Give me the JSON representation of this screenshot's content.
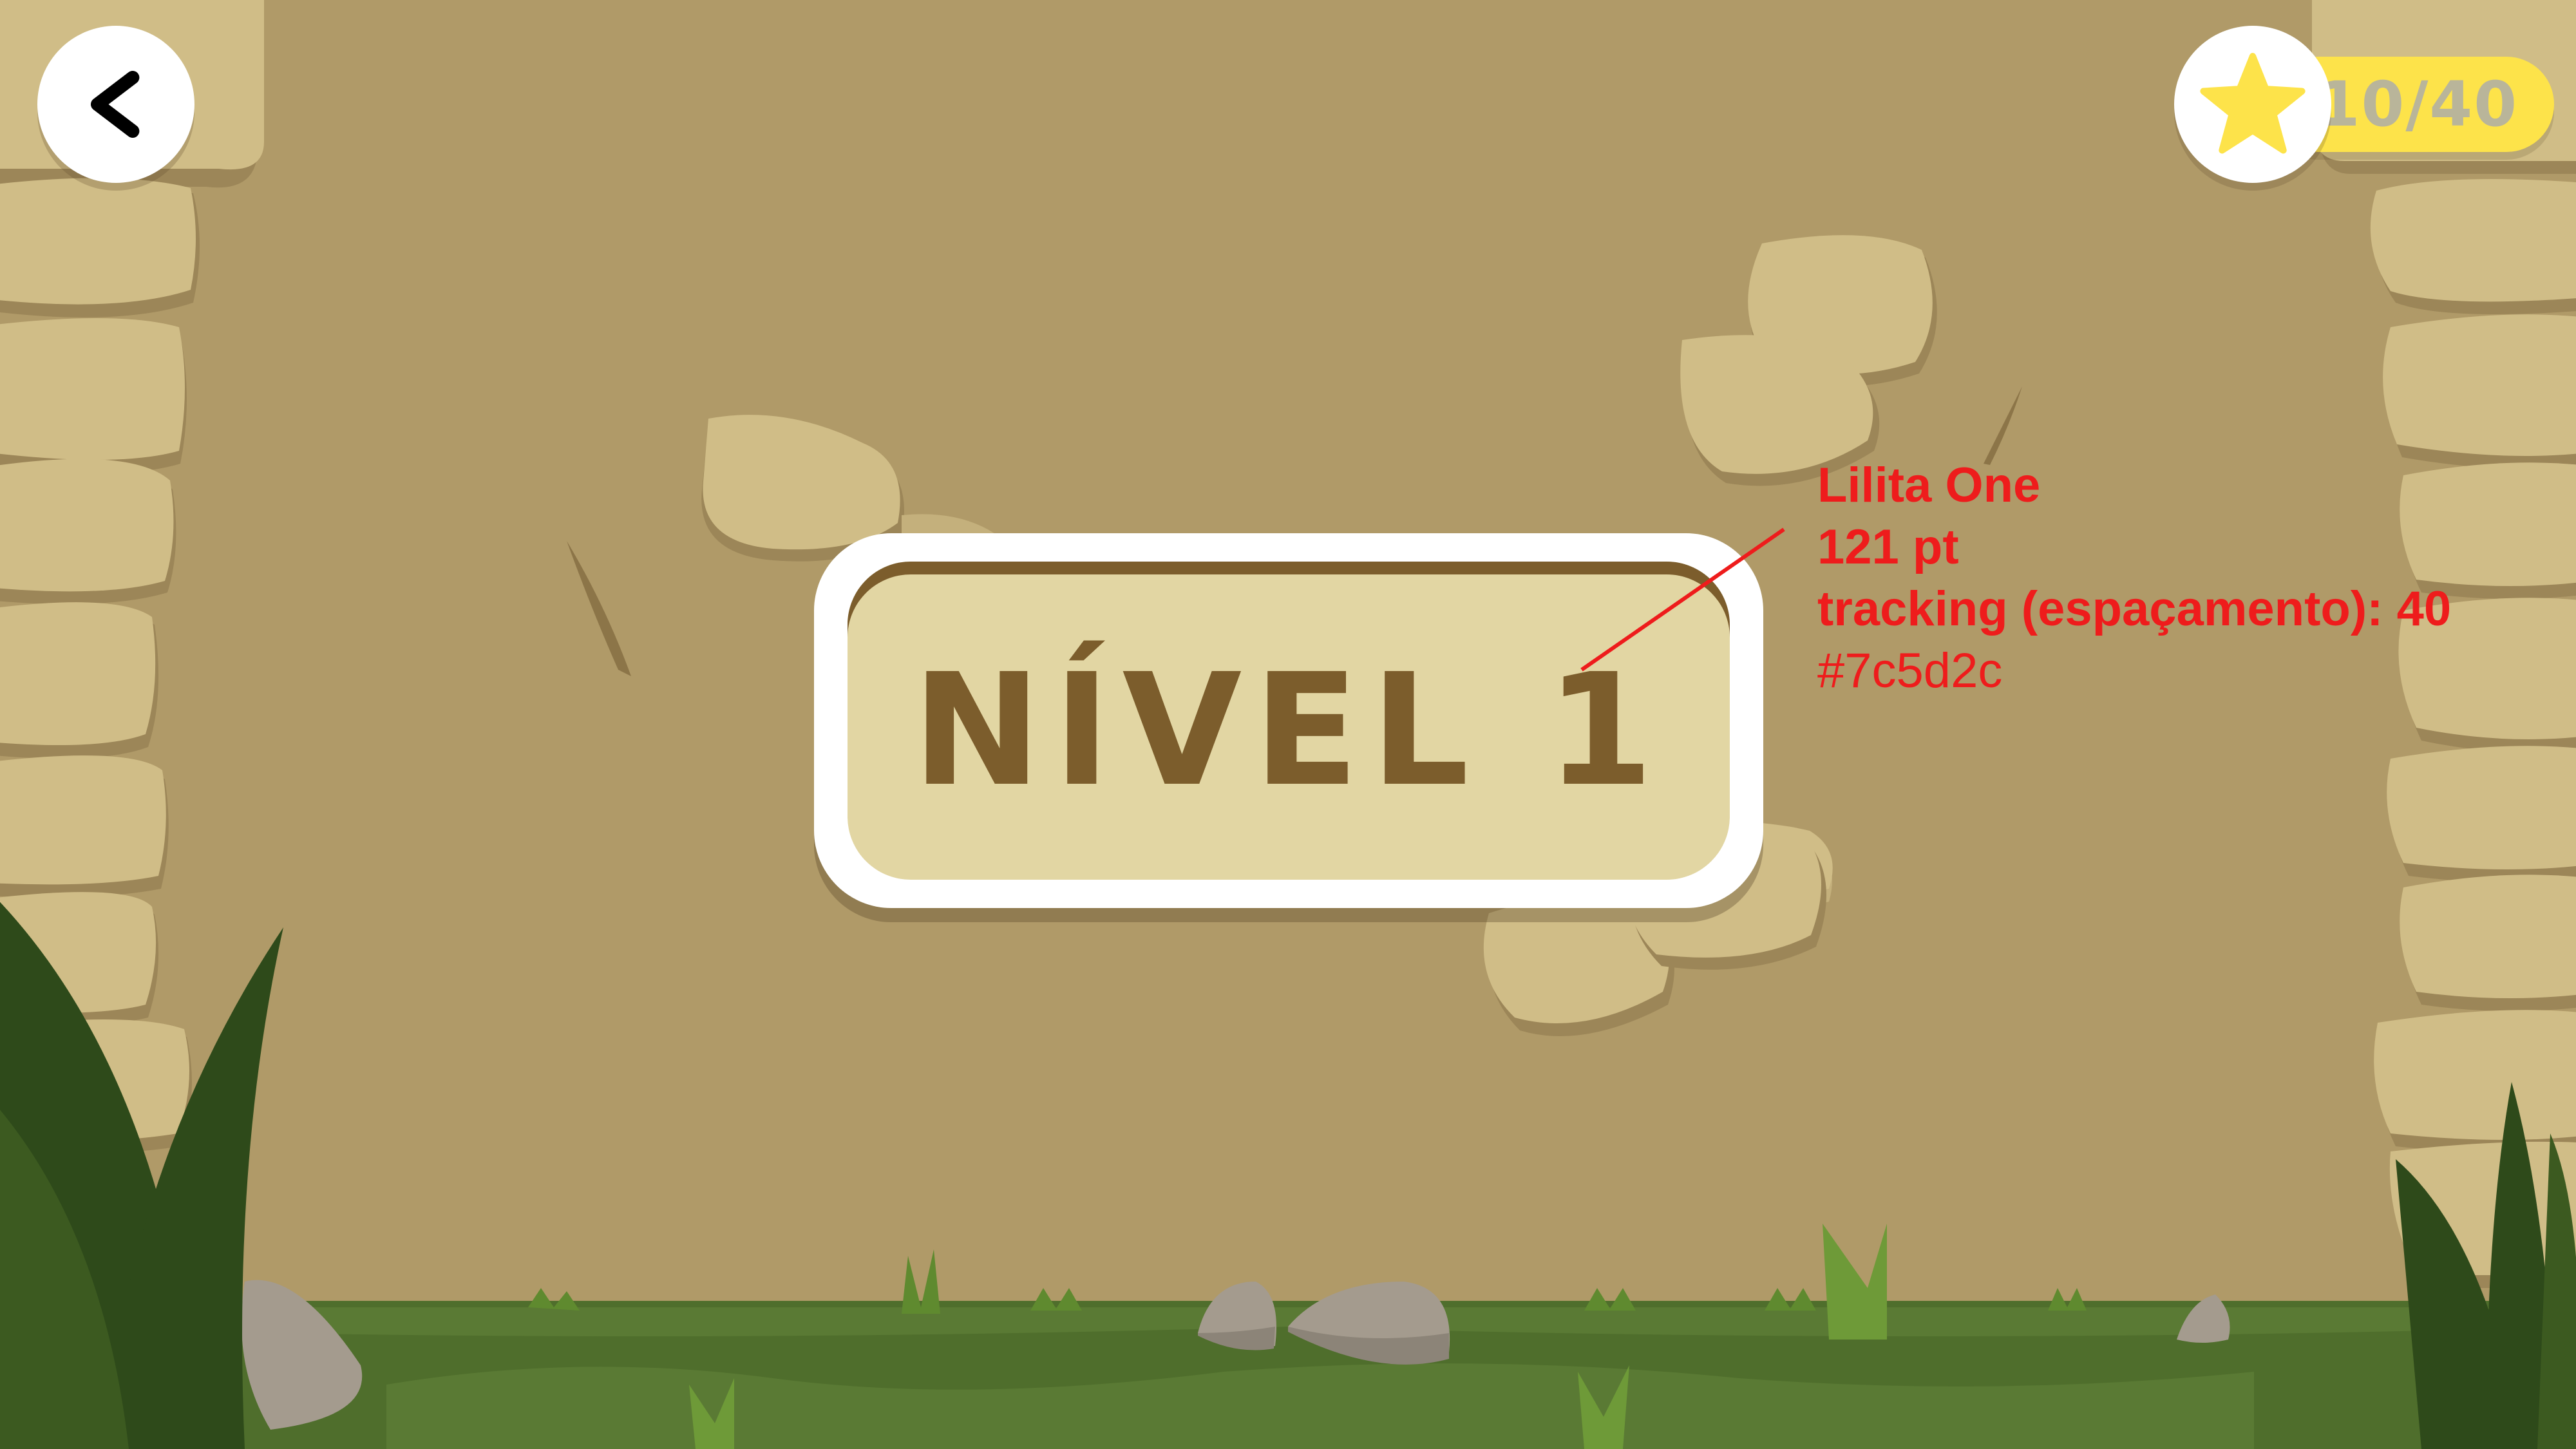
{
  "header": {
    "back_icon": "chevron-left-icon",
    "star_icon": "star-icon",
    "score": "10/40"
  },
  "level": {
    "title": "NÍVEL 1"
  },
  "annotation": {
    "font": "Lilita One",
    "size": "121 pt",
    "tracking": "tracking (espaçamento): 40",
    "color": "#7c5d2c"
  },
  "colors": {
    "background": "#b09a68",
    "stone": "#d0bd87",
    "grass": "#4f6e2c",
    "dark_leaves": "#2e4a1a",
    "star": "#fde34a",
    "level_text": "#7c5d2c",
    "annotation": "#ee1c1c"
  }
}
